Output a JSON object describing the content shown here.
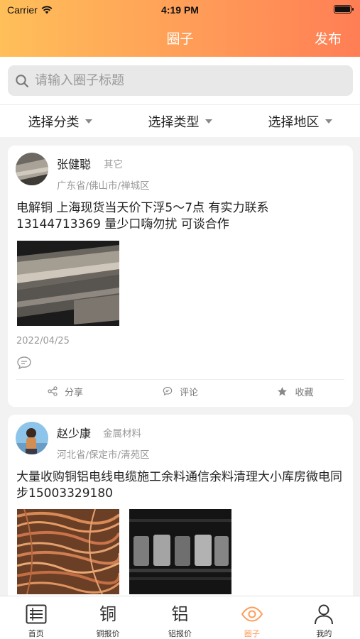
{
  "status_bar": {
    "carrier": "Carrier",
    "time": "4:19 PM"
  },
  "nav": {
    "title": "圈子",
    "action": "发布"
  },
  "search": {
    "placeholder": "请输入圈子标题"
  },
  "filters": [
    {
      "label": "选择分类"
    },
    {
      "label": "选择类型"
    },
    {
      "label": "选择地区"
    }
  ],
  "posts": [
    {
      "user": "张健聪",
      "category": "其它",
      "location": "广东省/佛山市/禅城区",
      "content": "电解铜 上海现货当天价下浮5～7点 有实力联系13144713369 量少口嗨勿扰 可谈合作",
      "date": "2022/04/25",
      "actions": {
        "share": "分享",
        "comment": "评论",
        "favorite": "收藏"
      }
    },
    {
      "user": "赵少康",
      "category": "金属材料",
      "location": "河北省/保定市/清苑区",
      "content": "大量收购铜铝电线电缆施工余料通信余料清理大小库房微电同步15003329180"
    }
  ],
  "tabbar": [
    {
      "label": "首页",
      "glyph": ""
    },
    {
      "label": "铜报价",
      "glyph": "铜"
    },
    {
      "label": "铝报价",
      "glyph": "铝"
    },
    {
      "label": "圈子",
      "glyph": "",
      "active": true
    },
    {
      "label": "我的",
      "glyph": ""
    }
  ],
  "colors": {
    "accent": "#ff9c58",
    "header_start": "#ffbf59",
    "header_end": "#ff7e55",
    "background": "#f2f2f2"
  }
}
